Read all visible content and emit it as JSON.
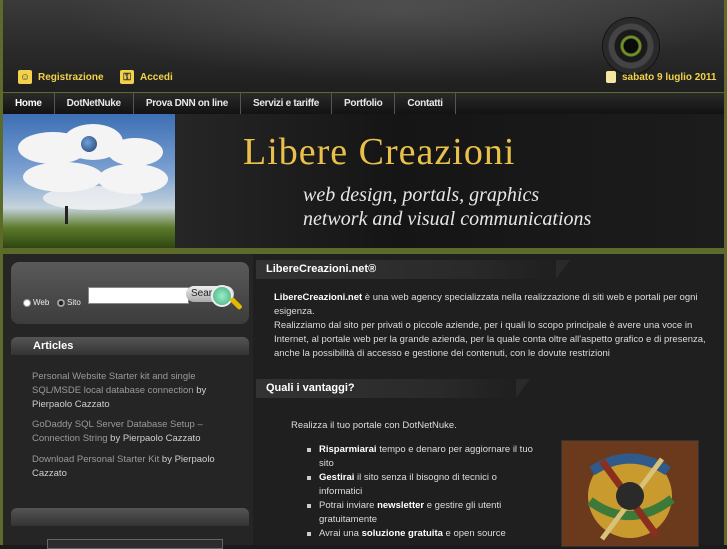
{
  "header": {
    "register_label": "Registrazione",
    "login_label": "Accedi",
    "date": "sabato 9 luglio 2011"
  },
  "nav": {
    "items": [
      "Home",
      "DotNetNuke",
      "Prova DNN on line",
      "Servizi e tariffe",
      "Portfolio",
      "Contatti"
    ]
  },
  "banner": {
    "title": "Libere Creazioni",
    "subtitle_line1": "web design, portals, graphics",
    "subtitle_line2": "network and visual communications"
  },
  "search": {
    "option_web": "Web",
    "option_site": "Sito",
    "input_value": "",
    "button_label": "Search"
  },
  "articles": {
    "heading": "Articles",
    "items": [
      {
        "title": "Personal Website Starter kit and single SQL/MSDE local database connection",
        "author": "by Pierpaolo Cazzato"
      },
      {
        "title": "GoDaddy SQL Server Database Setup – Connection String",
        "author": "by Pierpaolo Cazzato"
      },
      {
        "title": "Download Personal Starter Kit",
        "author": "by Pierpaolo Cazzato"
      }
    ]
  },
  "main": {
    "section1_heading": "LibereCreazioni.net®",
    "intro_brand": "LibereCreazioni.net",
    "intro_rest": " è una web agency specializzata nella realizzazione di siti web e portali per ogni esigenza.",
    "intro_p2": "Realizziamo dal sito per privati o piccole aziende, per i quali lo scopo principale è avere una voce in Internet, al portale web per la grande azienda, per la quale conta oltre all'aspetto grafico e di presenza, anche la possibilità di accesso e gestione dei contenuti, con le dovute restrizioni",
    "section2_heading": "Quali i vantaggi?",
    "lead": "Realizza il tuo portale con DotNetNuke.",
    "bullets": [
      {
        "strong": "Risparmiarai",
        "rest": " tempo e denaro per aggiornare il tuo sito"
      },
      {
        "strong": "Gestirai",
        "rest": " il sito senza il bisogno di tecnici o informatici"
      },
      {
        "pre": "Potrai inviare ",
        "strong": "newsletter",
        "rest": " e gestire gli utenti gratuitamente"
      },
      {
        "pre": "Avrai una ",
        "strong": "soluzione gratuita",
        "rest": " e open source"
      }
    ]
  },
  "colors": {
    "accent_gold": "#f2d24a",
    "olive_border": "#5d6b2a",
    "banner_title": "#e8c04a"
  }
}
